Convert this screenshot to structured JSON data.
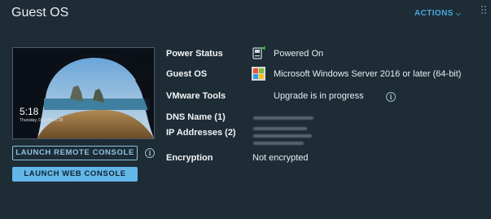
{
  "card": {
    "title": "Guest OS",
    "actions_label": "ACTIONS",
    "actions_icon": "chevron-down-icon"
  },
  "console_preview": {
    "time": "5:18",
    "date": "Thursday, December 28"
  },
  "buttons": {
    "launch_remote_console": "LAUNCH REMOTE CONSOLE",
    "launch_web_console": "LAUNCH WEB CONSOLE"
  },
  "details": {
    "power_status": {
      "label": "Power Status",
      "value": "Powered On",
      "icon": "power-on-icon"
    },
    "guest_os": {
      "label": "Guest OS",
      "value": "Microsoft Windows Server 2016 or later (64-bit)",
      "icon": "windows-logo-icon"
    },
    "vmware_tools": {
      "label": "VMware Tools",
      "value": "Upgrade is in progress"
    },
    "dns_name": {
      "label": "DNS Name (1)"
    },
    "ip_addresses": {
      "label": "IP Addresses (2)"
    },
    "encryption": {
      "label": "Encryption",
      "value": "Not encrypted"
    }
  },
  "colors": {
    "background": "#1e2c36",
    "accent": "#49a7d9",
    "primary_button": "#63b6e8"
  }
}
